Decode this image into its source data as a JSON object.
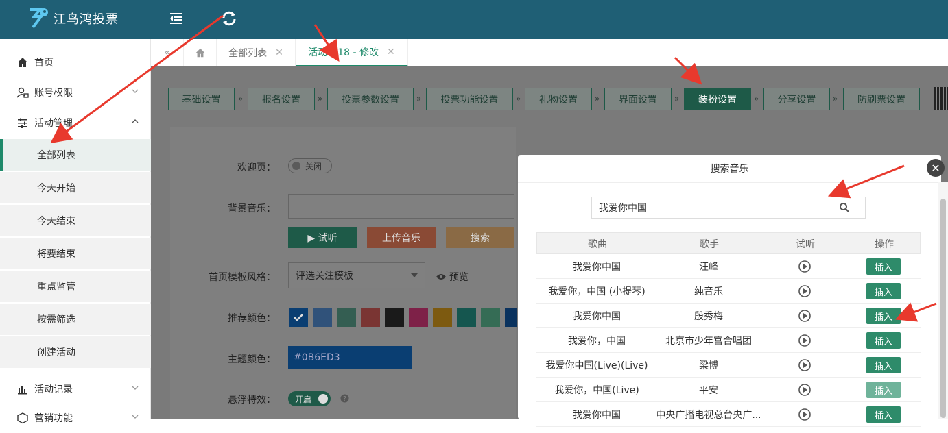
{
  "app": {
    "title": "江鸟鸿投票"
  },
  "sidebar": {
    "home": "首页",
    "account": "账号权限",
    "activity": "活动管理",
    "subs": [
      "全部列表",
      "今天开始",
      "今天结束",
      "将要结束",
      "重点监管",
      "按需筛选",
      "创建活动"
    ],
    "records": "活动记录",
    "marketing": "营销功能"
  },
  "tabs": [
    {
      "label": "全部列表"
    },
    {
      "label": "活动ID18 - 修改"
    }
  ],
  "steps": [
    "基础设置",
    "报名设置",
    "投票参数设置",
    "投票功能设置",
    "礼物设置",
    "界面设置",
    "装扮设置",
    "分享设置",
    "防刷票设置"
  ],
  "form": {
    "welcome_label": "欢迎页：",
    "welcome_toggle": "关闭",
    "music_label": "背景音乐：",
    "btn_listen": "▶ 试听",
    "btn_upload": "上传音乐",
    "btn_search": "搜索",
    "template_label": "首页模板风格：",
    "template_value": "评选关注模板",
    "preview": "预览",
    "rec_color_label": "推荐颜色：",
    "theme_label": "主题颜色：",
    "theme_value": "#0B6ED3",
    "float_label": "悬浮特效：",
    "float_toggle": "开启"
  },
  "colors": {
    "accent": "#1e8a6a",
    "topbar": "#1f5f75",
    "swatches": [
      "#0b6ed3",
      "#4a8fc8",
      "#4fa58a",
      "#e0453e",
      "#2b2b2b",
      "#e2226d",
      "#f0a000",
      "#0c9a8f",
      "#58b38d",
      "#0b4fa8"
    ]
  },
  "modal": {
    "title": "搜索音乐",
    "search_value": "我爱你中国",
    "headers": [
      "歌曲",
      "歌手",
      "试听",
      "操作"
    ],
    "insert_label": "插入",
    "rows": [
      {
        "song": "我爱你中国",
        "singer": "汪峰"
      },
      {
        "song": "我爱你，中国 (小提琴)",
        "singer": "纯音乐"
      },
      {
        "song": "我爱你中国",
        "singer": "殷秀梅"
      },
      {
        "song": "我爱你，中国",
        "singer": "北京市少年宫合唱团"
      },
      {
        "song": "我爱你中国(Live)(Live)",
        "singer": "梁博"
      },
      {
        "song": "我爱你，中国(Live)",
        "singer": "平安"
      },
      {
        "song": "我爱你中国",
        "singer": "中央广播电视总台央广..."
      }
    ]
  }
}
